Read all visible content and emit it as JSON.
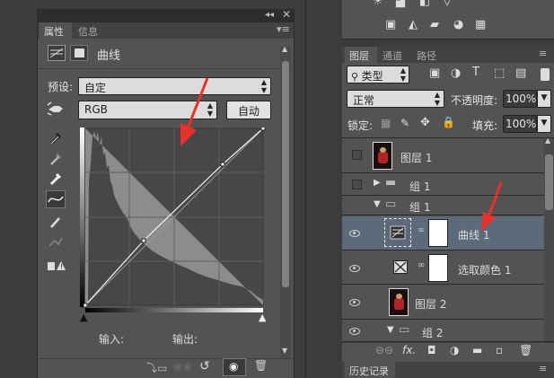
{
  "properties_panel": {
    "tabs": [
      "属性",
      "信息"
    ],
    "title": "曲线",
    "preset_label": "预设:",
    "preset_value": "自定",
    "channel_value": "RGB",
    "auto_button": "自动",
    "input_label": "输入:",
    "output_label": "输出:"
  },
  "layers_panel": {
    "tabs": [
      "图层",
      "通道",
      "路径"
    ],
    "filter_kind": "类型",
    "blend_mode": "正常",
    "opacity_label": "不透明度:",
    "opacity_value": "100%",
    "lock_label": "锁定:",
    "fill_label": "填充:",
    "fill_value": "100%",
    "layers": [
      {
        "name": "图层 1"
      },
      {
        "name": "组 1"
      },
      {
        "name": "组 1"
      },
      {
        "name": "曲线 1"
      },
      {
        "name": "选取颜色 1"
      },
      {
        "name": "图层 2"
      },
      {
        "name": "组 2"
      }
    ],
    "footer_labels": [
      "fx."
    ]
  },
  "history_panel": {
    "tab": "历史记录"
  },
  "colors": {
    "panel": "#535353",
    "dark": "#3c3c3c",
    "selected": "#5c6a7a",
    "annotation": "#e8312a"
  }
}
